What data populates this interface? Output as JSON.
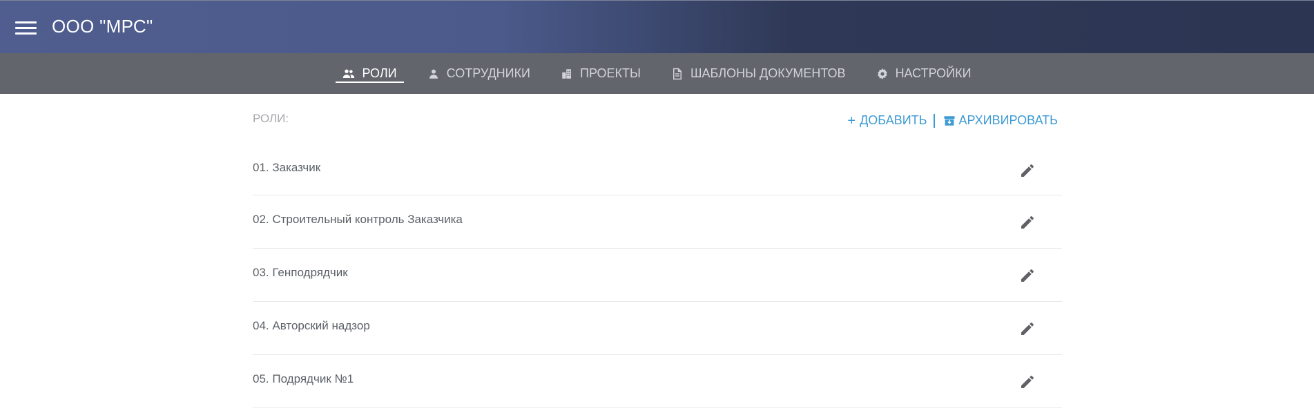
{
  "header": {
    "title": "ООО \"МРС\"",
    "menu_icon": "hamburger-menu-icon"
  },
  "nav": {
    "tabs": [
      {
        "label": "РОЛИ",
        "icon": "users-icon",
        "active": true
      },
      {
        "label": "СОТРУДНИКИ",
        "icon": "person-icon",
        "active": false
      },
      {
        "label": "ПРОЕКТЫ",
        "icon": "buildings-icon",
        "active": false
      },
      {
        "label": "ШАБЛОНЫ ДОКУМЕНТОВ",
        "icon": "document-icon",
        "active": false
      },
      {
        "label": "НАСТРОЙКИ",
        "icon": "gear-icon",
        "active": false
      }
    ]
  },
  "roles": {
    "label": "РОЛИ:",
    "add_label": "ДОБАВИТЬ",
    "archive_label": "АРХИВИРОВАТЬ",
    "items": [
      {
        "name": "01. Заказчик"
      },
      {
        "name": "02. Строительный контроль Заказчика"
      },
      {
        "name": "03. Генподрядчик"
      },
      {
        "name": "04. Авторский надзор"
      },
      {
        "name": "05. Подрядчик №1"
      }
    ]
  },
  "colors": {
    "accent": "#3d9bd4",
    "header_gradient_start": "#4f5d8f",
    "header_gradient_end": "#2c3552",
    "nav_bg": "#62656c",
    "text": "#5b5f66",
    "muted": "#a7a9ae"
  }
}
